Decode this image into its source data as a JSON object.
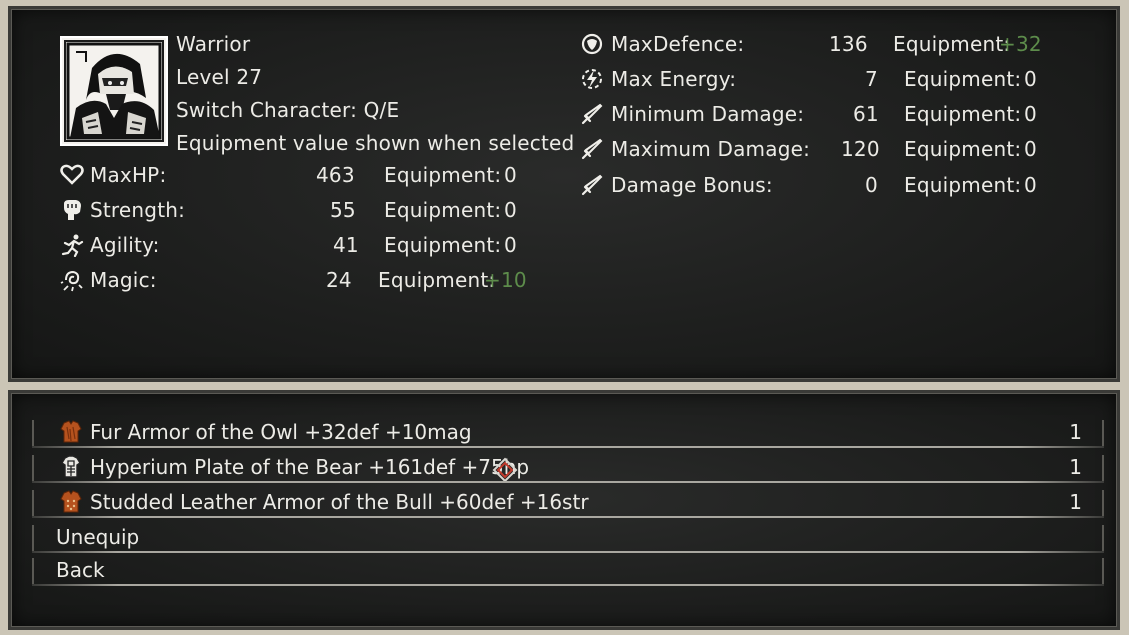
{
  "character": {
    "name": "Warrior",
    "level": "Level 27",
    "switch_hint": "Switch Character: Q/E",
    "equip_hint": "Equipment value shown when selected"
  },
  "stats_left": [
    {
      "icon": "heart-icon",
      "label": "MaxHP:",
      "value": "463",
      "equip_label": "Equipment:",
      "equip_value": "0",
      "highlight": false
    },
    {
      "icon": "fist-icon",
      "label": "Strength:",
      "value": "55",
      "equip_label": "Equipment:",
      "equip_value": "0",
      "highlight": false
    },
    {
      "icon": "running-icon",
      "label": "Agility:",
      "value": "41",
      "equip_label": "Equipment:",
      "equip_value": "0",
      "highlight": false
    },
    {
      "icon": "magic-icon",
      "label": "Magic:",
      "value": "24",
      "equip_label": "Equipment:",
      "equip_value": "+10",
      "highlight": true
    }
  ],
  "stats_right": [
    {
      "icon": "shield-icon",
      "label": "MaxDefence:",
      "value": "136",
      "equip_label": "Equipment:",
      "equip_value": "+32",
      "highlight": true
    },
    {
      "icon": "lightning-icon",
      "label": "Max Energy:",
      "value": "7",
      "equip_label": "Equipment:",
      "equip_value": "0",
      "highlight": false
    },
    {
      "icon": "sword-icon",
      "label": "Minimum Damage:",
      "value": "61",
      "equip_label": "Equipment:",
      "equip_value": "0",
      "highlight": false
    },
    {
      "icon": "sword-icon",
      "label": "Maximum Damage:",
      "value": "120",
      "equip_label": "Equipment:",
      "equip_value": "0",
      "highlight": false
    },
    {
      "icon": "sword-icon",
      "label": "Damage Bonus:",
      "value": "0",
      "equip_label": "Equipment:",
      "equip_value": "0",
      "highlight": false
    }
  ],
  "items": [
    {
      "icon": "fur-armor-icon",
      "label": "Fur Armor of the Owl +32def +10mag",
      "count": "1"
    },
    {
      "icon": "plate-armor-icon",
      "label": "Hyperium Plate of the Bear +161def +75hp",
      "count": "1"
    },
    {
      "icon": "leather-armor-icon",
      "label": "Studded Leather Armor of the Bull +60def +16str",
      "count": "1"
    }
  ],
  "actions": {
    "unequip": "Unequip",
    "back": "Back"
  },
  "colors": {
    "panel": "#1e1f1e",
    "text": "#ecebe6",
    "bonus_green": "#5d8c4b",
    "frame": "#cbc5b6"
  }
}
